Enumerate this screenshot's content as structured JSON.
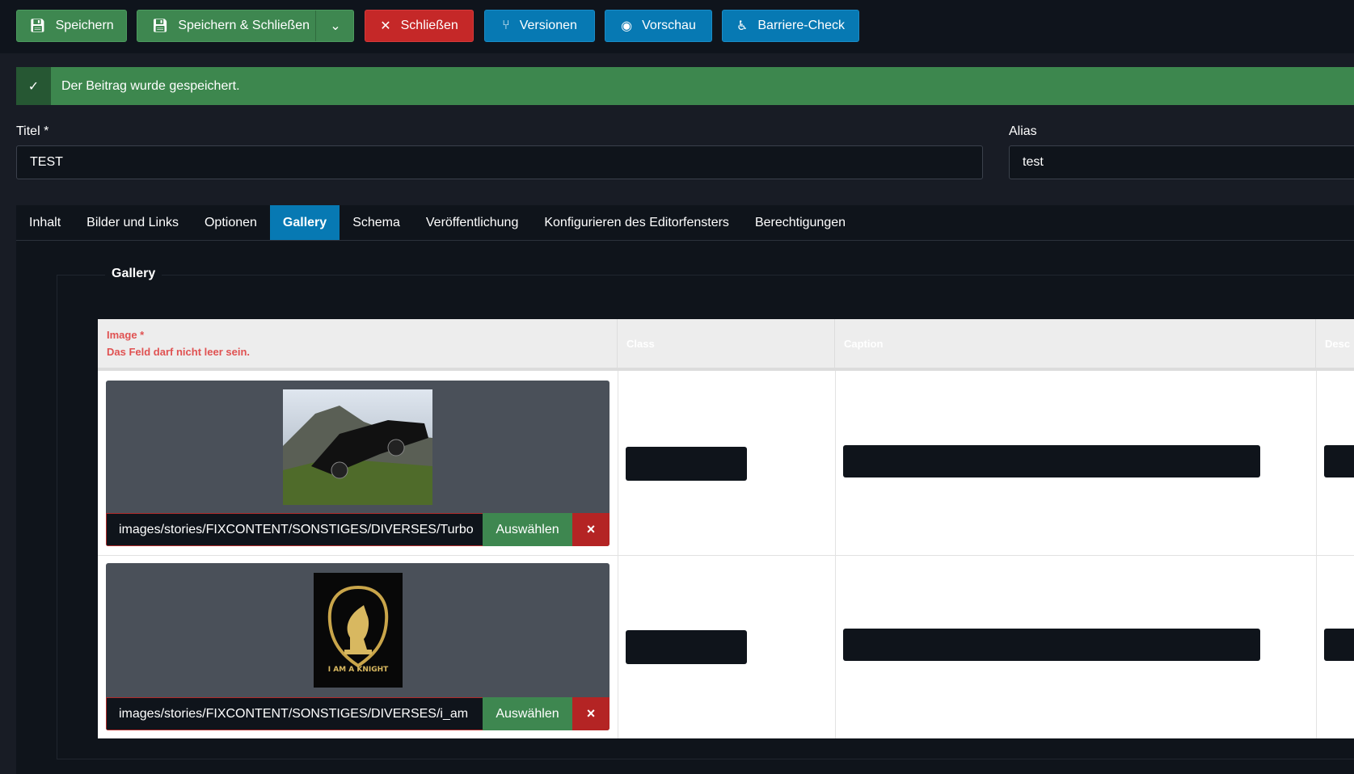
{
  "toolbar": {
    "save": "Speichern",
    "save_close": "Speichern & Schließen",
    "close": "Schließen",
    "versions": "Versionen",
    "preview": "Vorschau",
    "a11y": "Barriere-Check"
  },
  "alert": {
    "message": "Der Beitrag wurde gespeichert."
  },
  "form": {
    "title_label": "Titel *",
    "title_value": "TEST",
    "alias_label": "Alias",
    "alias_value": "test"
  },
  "tabs": [
    "Inhalt",
    "Bilder und Links",
    "Optionen",
    "Gallery",
    "Schema",
    "Veröffentlichung",
    "Konfigurieren des Editorfensters",
    "Berechtigungen"
  ],
  "active_tab": "Gallery",
  "gallery": {
    "legend": "Gallery",
    "headers": {
      "image": "Image *",
      "image_error": "Das Feld darf nicht leer sein.",
      "class": "Class",
      "caption": "Caption",
      "description": "Desc"
    },
    "rows": [
      {
        "path": "images/stories/FIXCONTENT/SONSTIGES/DIVERSES/Turbo",
        "select": "Auswählen",
        "clear": "×"
      },
      {
        "path": "images/stories/FIXCONTENT/SONSTIGES/DIVERSES/i_am",
        "select": "Auswählen",
        "clear": "×",
        "image_text": "I AM A KNIGHT"
      }
    ]
  },
  "colors": {
    "green": "#3e8750",
    "red": "#c52828",
    "blue": "#0779b3",
    "error": "#e05252"
  }
}
